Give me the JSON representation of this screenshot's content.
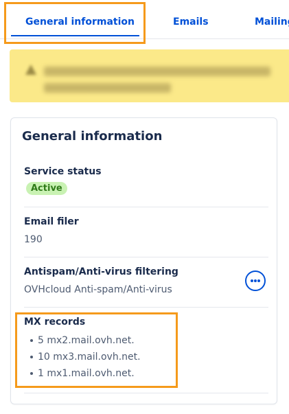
{
  "tabs": [
    {
      "label": "General information",
      "active": true
    },
    {
      "label": "Emails",
      "active": false
    },
    {
      "label": "Mailing",
      "active": false
    }
  ],
  "colors": {
    "accent": "#0050d7",
    "highlight": "#f59a1b",
    "banner": "#fbe989",
    "badge_bg": "#c9f2b3",
    "badge_text": "#2f7a19"
  },
  "card": {
    "title": "General information",
    "service_status": {
      "label": "Service status",
      "badge": "Active"
    },
    "email_filer": {
      "label": "Email filer",
      "value": "190"
    },
    "antispam": {
      "label": "Antispam/Anti-virus filtering",
      "value": "OVHcloud Anti-spam/Anti-virus",
      "action_icon": "more-options-icon"
    },
    "mx_records": {
      "label": "MX records",
      "items": [
        "5 mx2.mail.ovh.net.",
        "10 mx3.mail.ovh.net.",
        "1 mx1.mail.ovh.net."
      ]
    }
  }
}
